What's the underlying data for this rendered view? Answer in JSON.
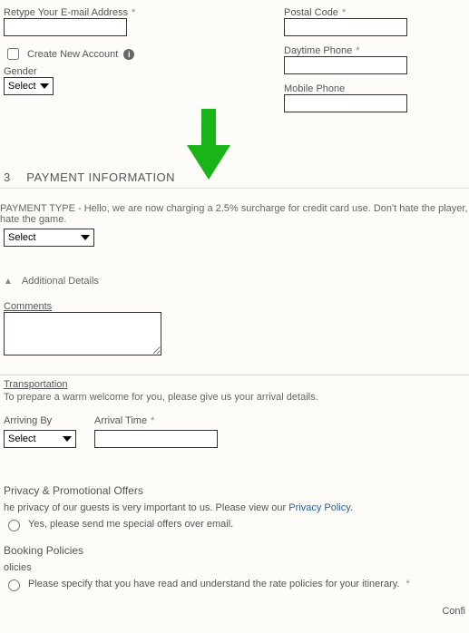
{
  "left": {
    "retype_email_label": "Retype Your E-mail Address",
    "create_account_label": "Create New Account",
    "gender_label": "Gender",
    "gender_value": "Select"
  },
  "right": {
    "postal_label": "Postal Code",
    "daytime_phone_label": "Daytime Phone",
    "mobile_phone_label": "Mobile Phone"
  },
  "section3": {
    "num": "3",
    "title": "PAYMENT INFORMATION",
    "payment_type_text": "PAYMENT TYPE - Hello, we are now charging a 2.5% surcharge for credit card use. Don't hate the player, hate the game.",
    "select_value": "Select"
  },
  "details": {
    "toggle_label": "Additional Details",
    "comments_label": "Comments"
  },
  "transport": {
    "header": "Transportation",
    "note": "To prepare a warm welcome for you, please give us your arrival details.",
    "arriving_by": "Arriving By",
    "arriving_value": "Select",
    "arrival_time": "Arrival Time"
  },
  "privacy": {
    "header": "Privacy & Promotional Offers",
    "text_prefix": "he privacy of our guests is very important to us. Please view our ",
    "link": "Privacy Policy",
    "checkbox_label": "Yes, please send me special offers over email."
  },
  "booking": {
    "header": "Booking Policies",
    "sub": "olicies",
    "checkbox_label": "Please specify that you have read and understand the rate policies for your itinerary."
  },
  "confirm_label": "Confi",
  "asterisk": "*"
}
